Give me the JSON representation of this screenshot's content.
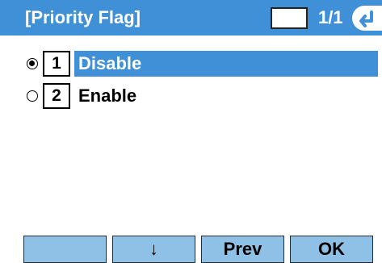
{
  "header": {
    "title": "[Priority Flag]",
    "page_indicator": "1/1",
    "back_icon": "return-arrow-icon"
  },
  "menu": {
    "items": [
      {
        "number": "1",
        "label": "Disable",
        "selected": true
      },
      {
        "number": "2",
        "label": "Enable",
        "selected": false
      }
    ]
  },
  "softkeys": {
    "sk1": "",
    "sk2": "↓",
    "sk3": "Prev",
    "sk4": "OK"
  },
  "colors": {
    "accent": "#3f90d6",
    "softkey_bg": "#8fc0e5"
  }
}
